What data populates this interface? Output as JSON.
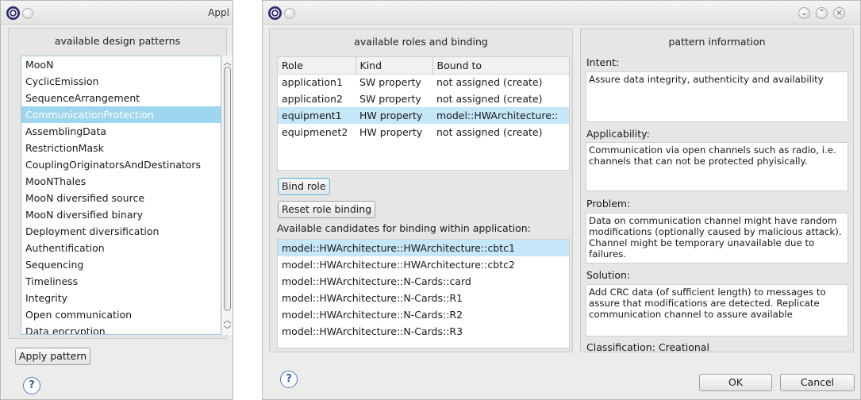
{
  "left_window": {
    "title": "Appl",
    "patterns_header": "available design patterns",
    "patterns": [
      "MooN",
      "CyclicEmission",
      "SequenceArrangement",
      "CommunicationProtection",
      "AssemblingData",
      "RestrictionMask",
      "CouplingOriginatorsAndDestinators",
      "MooNThales",
      "MooN diversified source",
      "MooN diversified binary",
      "Deployment diversification",
      "Authentification",
      "Sequencing",
      "Timeliness",
      "Integrity",
      "Open communication",
      "Data encryption"
    ],
    "selected_pattern": "CommunicationProtection",
    "apply_button": "Apply pattern",
    "help_glyph": "?"
  },
  "right_window": {
    "window_controls": {
      "minimize": "⌄",
      "maximize": "⌃",
      "close": "×"
    },
    "roles_header": "available roles and binding",
    "roles_table": {
      "columns": [
        "Role",
        "Kind",
        "Bound to"
      ],
      "rows": [
        {
          "role": "application1",
          "kind": "SW property",
          "bound": "not assigned (create)"
        },
        {
          "role": "application2",
          "kind": "SW property",
          "bound": "not assigned (create)"
        },
        {
          "role": "equipment1",
          "kind": "HW property",
          "bound": "model::HWArchitecture::"
        },
        {
          "role": "equipmenet2",
          "kind": "HW property",
          "bound": "not assigned (create)"
        }
      ],
      "selected_row": "equipment1"
    },
    "bind_role_button": "Bind role",
    "reset_binding_button": "Reset role binding",
    "candidates_label": "Available candidates for binding within application:",
    "candidates": [
      "model::HWArchitecture::HWArchitecture::cbtc1",
      "model::HWArchitecture::HWArchitecture::cbtc2",
      "model::HWArchitecture::N-Cards::card",
      "model::HWArchitecture::N-Cards::R1",
      "model::HWArchitecture::N-Cards::R2",
      "model::HWArchitecture::N-Cards::R3"
    ],
    "selected_candidate": "model::HWArchitecture::HWArchitecture::cbtc1",
    "info_header": "pattern information",
    "intent_label": "Intent:",
    "intent_text": "Assure data integrity, authenticity and availability",
    "applicability_label": "Applicability:",
    "applicability_text": "Communication via open channels such as radio, i.e. channels that can not be protected phyisically.",
    "problem_label": "Problem:",
    "problem_text": "Data on communication channel might have random modifications (optionally caused by malicious attack). Channel might be temporary unavailable due to failures.",
    "solution_label": "Solution:",
    "solution_text": "Add CRC data (of sufficient length) to messages to assure that modifications are detected. Replicate communication channel to assure available",
    "classification": "Classification: Creational",
    "ok_button": "OK",
    "cancel_button": "Cancel",
    "help_glyph": "?"
  }
}
